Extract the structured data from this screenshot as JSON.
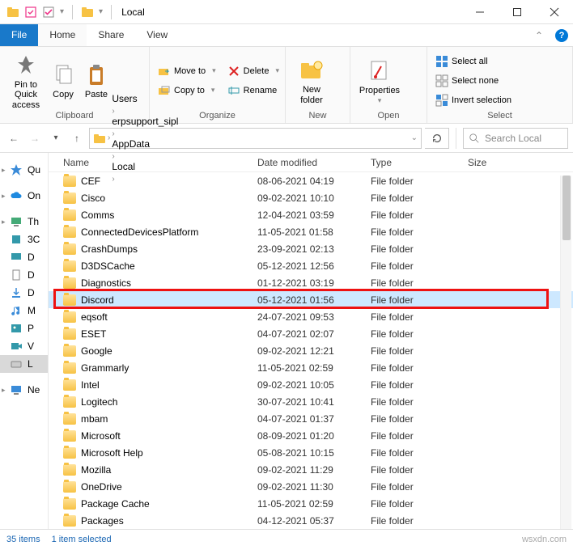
{
  "title": "Local",
  "ribbonTabs": {
    "file": "File",
    "home": "Home",
    "share": "Share",
    "view": "View"
  },
  "ribbon": {
    "clipboard": {
      "label": "Clipboard",
      "pin": "Pin to Quick\naccess",
      "copy": "Copy",
      "paste": "Paste"
    },
    "organize": {
      "label": "Organize",
      "moveTo": "Move to",
      "copyTo": "Copy to",
      "delete": "Delete",
      "rename": "Rename"
    },
    "new": {
      "label": "New",
      "newFolder": "New\nfolder"
    },
    "open": {
      "label": "Open",
      "properties": "Properties"
    },
    "select": {
      "label": "Select",
      "selectAll": "Select all",
      "selectNone": "Select none",
      "invert": "Invert selection"
    }
  },
  "breadcrumb": [
    "Users",
    "erpsupport_sipl",
    "AppData",
    "Local"
  ],
  "searchPlaceholder": "Search Local",
  "sidebar": {
    "items": [
      {
        "label": "Qu",
        "kind": "quick"
      },
      {
        "label": "On",
        "kind": "onedrive"
      },
      {
        "label": "Th",
        "kind": "pc"
      },
      {
        "label": "3C",
        "kind": "3d"
      },
      {
        "label": "D",
        "kind": "desktop"
      },
      {
        "label": "D",
        "kind": "documents"
      },
      {
        "label": "D",
        "kind": "downloads"
      },
      {
        "label": "M",
        "kind": "music"
      },
      {
        "label": "P",
        "kind": "pictures"
      },
      {
        "label": "V",
        "kind": "videos"
      },
      {
        "label": "L",
        "kind": "disk",
        "selected": true
      },
      {
        "label": "Ne",
        "kind": "network"
      }
    ]
  },
  "columns": {
    "name": "Name",
    "date": "Date modified",
    "type": "Type",
    "size": "Size"
  },
  "files": [
    {
      "name": "CEF",
      "date": "08-06-2021 04:19",
      "type": "File folder"
    },
    {
      "name": "Cisco",
      "date": "09-02-2021 10:10",
      "type": "File folder"
    },
    {
      "name": "Comms",
      "date": "12-04-2021 03:59",
      "type": "File folder"
    },
    {
      "name": "ConnectedDevicesPlatform",
      "date": "11-05-2021 01:58",
      "type": "File folder"
    },
    {
      "name": "CrashDumps",
      "date": "23-09-2021 02:13",
      "type": "File folder"
    },
    {
      "name": "D3DSCache",
      "date": "05-12-2021 12:56",
      "type": "File folder"
    },
    {
      "name": "Diagnostics",
      "date": "01-12-2021 03:19",
      "type": "File folder"
    },
    {
      "name": "Discord",
      "date": "05-12-2021 01:56",
      "type": "File folder",
      "selected": true
    },
    {
      "name": "eqsoft",
      "date": "24-07-2021 09:53",
      "type": "File folder"
    },
    {
      "name": "ESET",
      "date": "04-07-2021 02:07",
      "type": "File folder"
    },
    {
      "name": "Google",
      "date": "09-02-2021 12:21",
      "type": "File folder"
    },
    {
      "name": "Grammarly",
      "date": "11-05-2021 02:59",
      "type": "File folder"
    },
    {
      "name": "Intel",
      "date": "09-02-2021 10:05",
      "type": "File folder"
    },
    {
      "name": "Logitech",
      "date": "30-07-2021 10:41",
      "type": "File folder"
    },
    {
      "name": "mbam",
      "date": "04-07-2021 01:37",
      "type": "File folder"
    },
    {
      "name": "Microsoft",
      "date": "08-09-2021 01:20",
      "type": "File folder"
    },
    {
      "name": "Microsoft Help",
      "date": "05-08-2021 10:15",
      "type": "File folder"
    },
    {
      "name": "Mozilla",
      "date": "09-02-2021 11:29",
      "type": "File folder"
    },
    {
      "name": "OneDrive",
      "date": "09-02-2021 11:30",
      "type": "File folder"
    },
    {
      "name": "Package Cache",
      "date": "11-05-2021 02:59",
      "type": "File folder"
    },
    {
      "name": "Packages",
      "date": "04-12-2021 05:37",
      "type": "File folder"
    }
  ],
  "highlightIndex": 7,
  "status": {
    "count": "35 items",
    "selected": "1 item selected"
  },
  "watermark": "wsxdn.com"
}
